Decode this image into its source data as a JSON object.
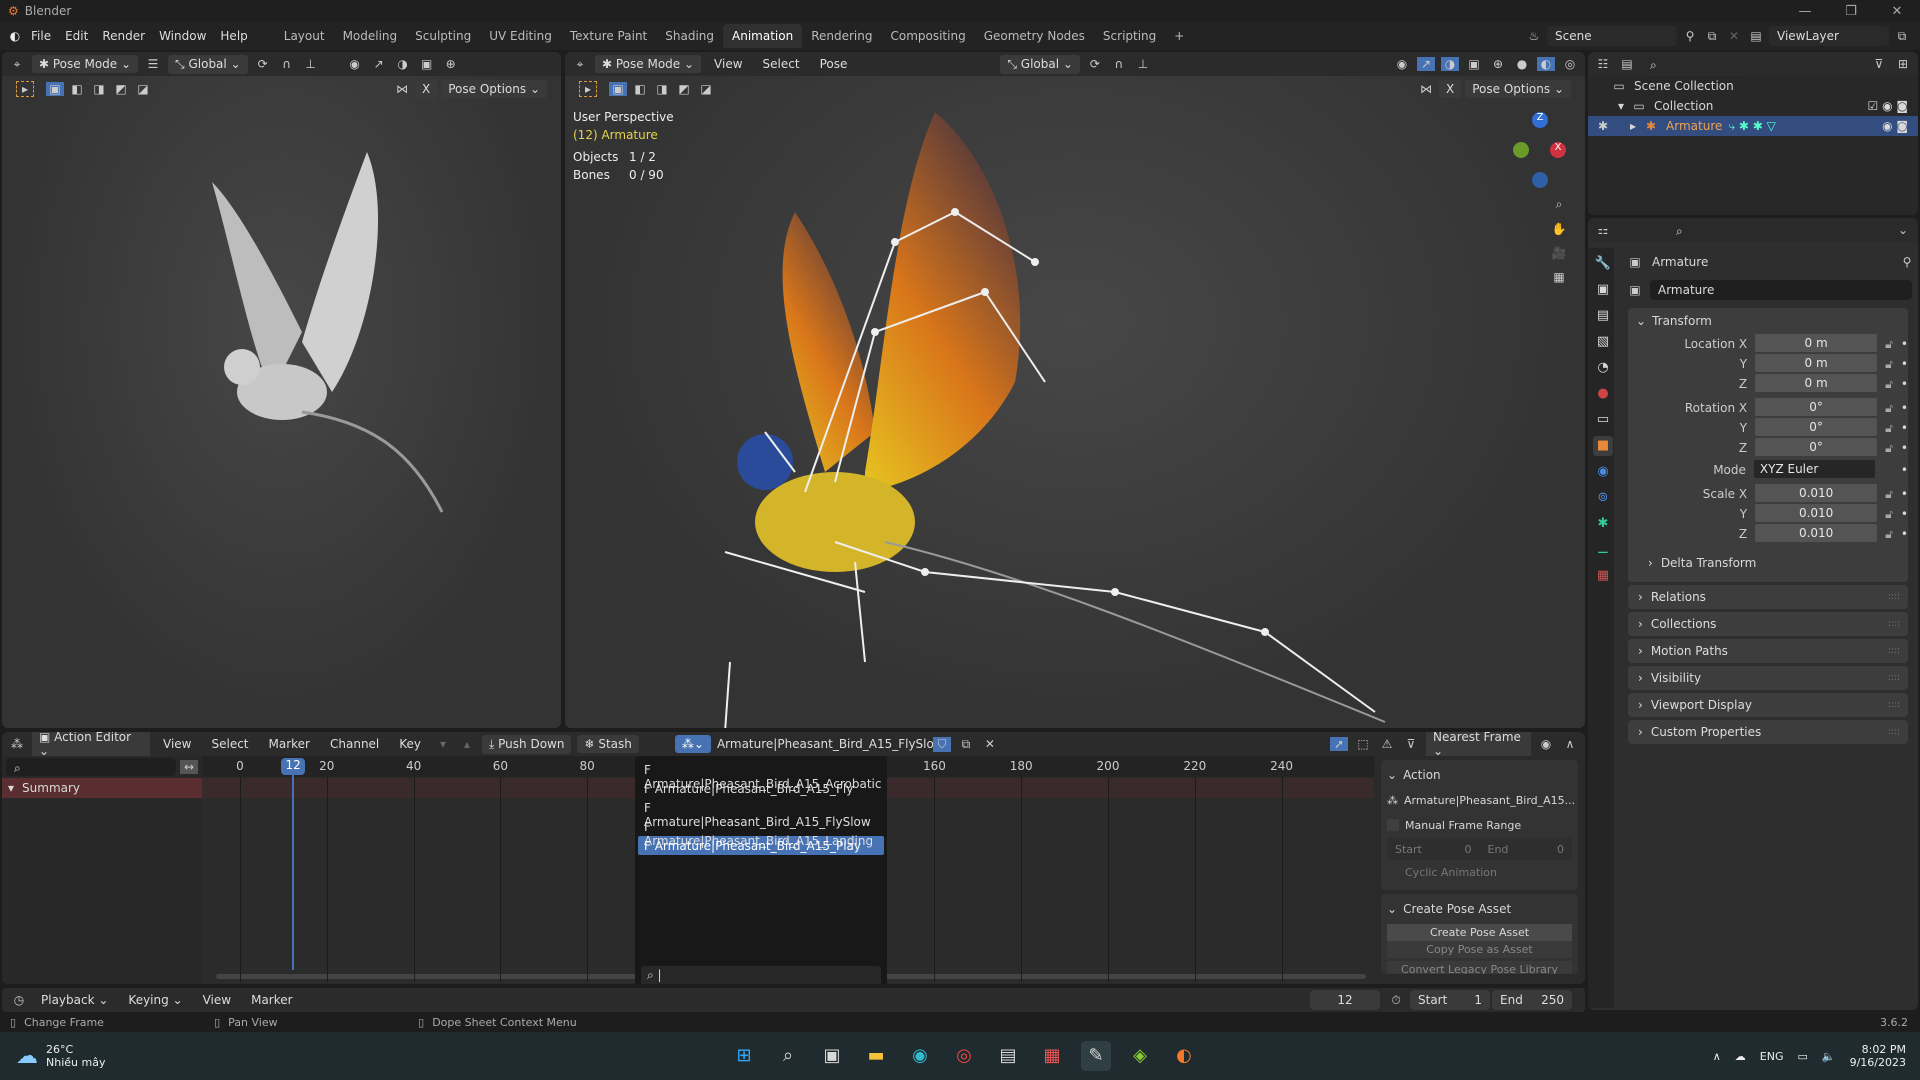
{
  "app": {
    "title": "Blender",
    "version": "3.6.2"
  },
  "menu": [
    "File",
    "Edit",
    "Render",
    "Window",
    "Help"
  ],
  "workspaces": [
    "Layout",
    "Modeling",
    "Sculpting",
    "UV Editing",
    "Texture Paint",
    "Shading",
    "Animation",
    "Rendering",
    "Compositing",
    "Geometry Nodes",
    "Scripting"
  ],
  "active_workspace": "Animation",
  "scene": {
    "name": "Scene",
    "view_layer": "ViewLayer"
  },
  "left_viewport": {
    "mode": "Pose Mode",
    "orientation": "Global",
    "pose_options": "Pose Options",
    "x_label": "X"
  },
  "main_viewport": {
    "mode": "Pose Mode",
    "menus": [
      "View",
      "Select",
      "Pose"
    ],
    "orientation": "Global",
    "pose_options": "Pose Options",
    "x_label": "X",
    "overlay": {
      "perspective": "User Perspective",
      "active": "(12) Armature",
      "objects_label": "Objects",
      "objects_value": "1 / 2",
      "bones_label": "Bones",
      "bones_value": "0 / 90"
    },
    "gizmo": {
      "z": "Z",
      "x": "X"
    }
  },
  "outliner": {
    "scene_collection": "Scene Collection",
    "collection": "Collection",
    "armature": "Armature"
  },
  "properties": {
    "object_name": "Armature",
    "data_name": "Armature",
    "transform": "Transform",
    "location": [
      {
        "label": "Location X",
        "value": "0 m"
      },
      {
        "label": "Y",
        "value": "0 m"
      },
      {
        "label": "Z",
        "value": "0 m"
      }
    ],
    "rotation": [
      {
        "label": "Rotation X",
        "value": "0°"
      },
      {
        "label": "Y",
        "value": "0°"
      },
      {
        "label": "Z",
        "value": "0°"
      }
    ],
    "mode_label": "Mode",
    "mode_value": "XYZ Euler",
    "scale": [
      {
        "label": "Scale X",
        "value": "0.010"
      },
      {
        "label": "Y",
        "value": "0.010"
      },
      {
        "label": "Z",
        "value": "0.010"
      }
    ],
    "delta": "Delta Transform",
    "panels": [
      "Relations",
      "Collections",
      "Motion Paths",
      "Visibility",
      "Viewport Display",
      "Custom Properties"
    ]
  },
  "dopesheet": {
    "editor": "Action Editor",
    "menus": [
      "View",
      "Select",
      "Marker",
      "Channel",
      "Key"
    ],
    "push_down": "Push Down",
    "stash": "Stash",
    "action": "Armature|Pheasant_Bird_A15_FlySlow",
    "snap": "Nearest Frame",
    "summary": "Summary",
    "current_frame": "12",
    "ruler": [
      0,
      20,
      40,
      60,
      80,
      160,
      180,
      200,
      220,
      240
    ],
    "actions": [
      "F Armature|Pheasant_Bird_A15_Acrobatic",
      "F Armature|Pheasant_Bird_A15_Fly",
      "F Armature|Pheasant_Bird_A15_FlySlow",
      "F Armature|Pheasant_Bird_A15_Landing",
      "F Armature|Pheasant_Bird_A15_Play"
    ],
    "selected_action_index": 4,
    "sidebar": {
      "action_title": "Action",
      "action_name": "Armature|Pheasant_Bird_A15...",
      "manual_range": "Manual Frame Range",
      "start_label": "Start",
      "start": "0",
      "end_label": "End",
      "end": "0",
      "cyclic": "Cyclic Animation",
      "pose_title": "Create Pose Asset",
      "create_pose": "Create Pose Asset",
      "copy_pose": "Copy Pose as Asset",
      "convert": "Convert Legacy Pose Library"
    }
  },
  "timeline": {
    "menus": [
      "Playback",
      "Keying",
      "View",
      "Marker"
    ],
    "frame": "12",
    "start_label": "Start",
    "start": "1",
    "end_label": "End",
    "end": "250"
  },
  "statusbar": {
    "change_frame": "Change Frame",
    "pan_view": "Pan View",
    "context_menu": "Dope Sheet Context Menu"
  },
  "taskbar": {
    "temp": "26°C",
    "weather": "Nhiều mây",
    "lang": "ENG",
    "time": "8:02 PM",
    "date": "9/16/2023"
  }
}
